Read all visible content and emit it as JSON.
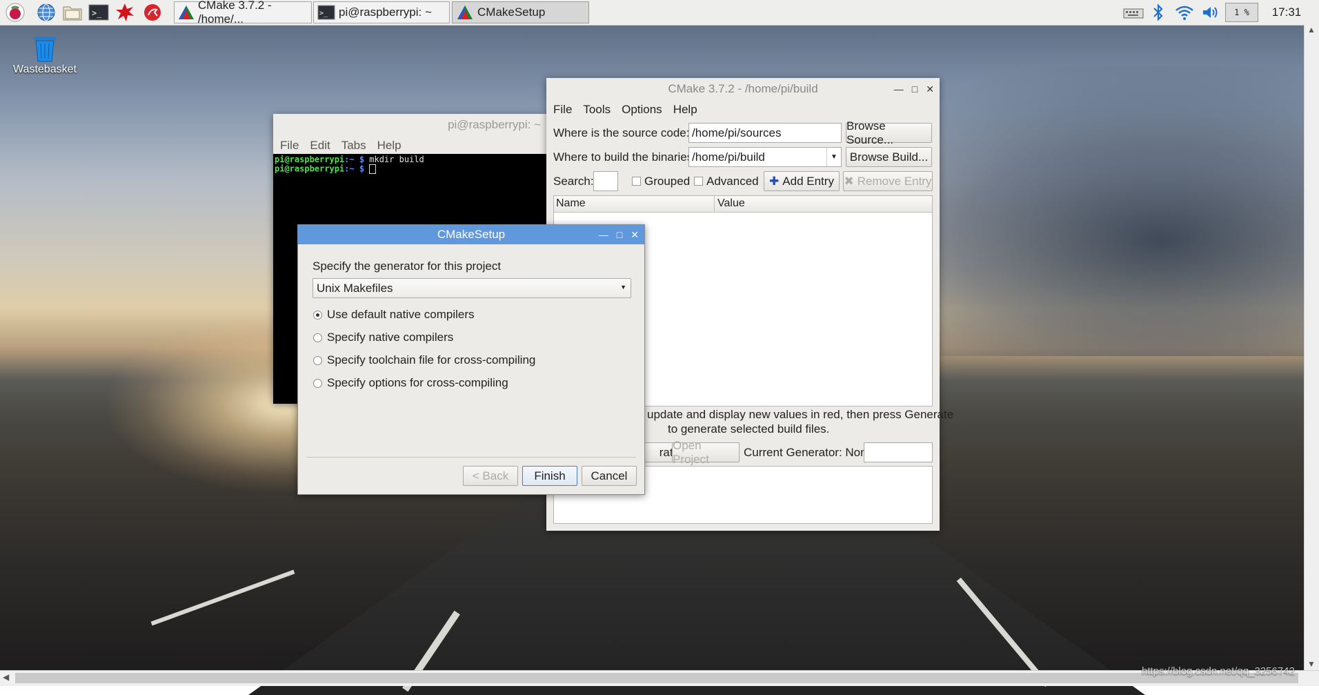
{
  "taskbar": {
    "launchers": [
      "raspberry-menu-icon",
      "web-browser-icon",
      "file-manager-icon",
      "terminal-icon",
      "mathematica-icon",
      "wolfram-icon"
    ],
    "tasks": [
      {
        "label": "CMake 3.7.2 - /home/..."
      },
      {
        "label": "pi@raspberrypi: ~"
      },
      {
        "label": "CMakeSetup"
      }
    ],
    "cpu": "1 %",
    "clock": "17:31"
  },
  "desktop": {
    "wastebasket_label": "Wastebasket",
    "watermark": "https://blog.csdn.net/qq_3256742"
  },
  "terminal": {
    "title": "pi@raspberrypi: ~",
    "menu": [
      "File",
      "Edit",
      "Tabs",
      "Help"
    ],
    "lines": [
      {
        "user": "pi@raspberrypi",
        "path": ":~ $",
        "cmd": " mkdir build"
      },
      {
        "user": "pi@raspberrypi",
        "path": ":~ $",
        "cmd": " "
      }
    ]
  },
  "cmake": {
    "title": "CMake 3.7.2 - /home/pi/build",
    "menu": [
      "File",
      "Tools",
      "Options",
      "Help"
    ],
    "source_label": "Where is the source code:",
    "source_value": "/home/pi/sources",
    "browse_source": "Browse Source...",
    "build_label": "Where to build the binaries:",
    "build_value": "/home/pi/build",
    "browse_build": "Browse Build...",
    "search_label": "Search:",
    "grouped_label": "Grouped",
    "advanced_label": "Advanced",
    "add_entry": "Add Entry",
    "remove_entry": "Remove Entry",
    "col_name": "Name",
    "col_value": "Value",
    "info_line1": "update and display new values in red, then press Generate",
    "info_line2": "to generate selected build files.",
    "generate_fragment": "rate",
    "open_project": "Open Project",
    "current_generator": "Current Generator: None"
  },
  "setup": {
    "title": "CMakeSetup",
    "prompt": "Specify the generator for this project",
    "generator": "Unix Makefiles",
    "options": [
      {
        "label": "Use default native compilers",
        "selected": true
      },
      {
        "label": "Specify native compilers",
        "selected": false
      },
      {
        "label": "Specify toolchain file for cross-compiling",
        "selected": false
      },
      {
        "label": "Specify options for cross-compiling",
        "selected": false
      }
    ],
    "back": "< Back",
    "finish": "Finish",
    "cancel": "Cancel"
  }
}
